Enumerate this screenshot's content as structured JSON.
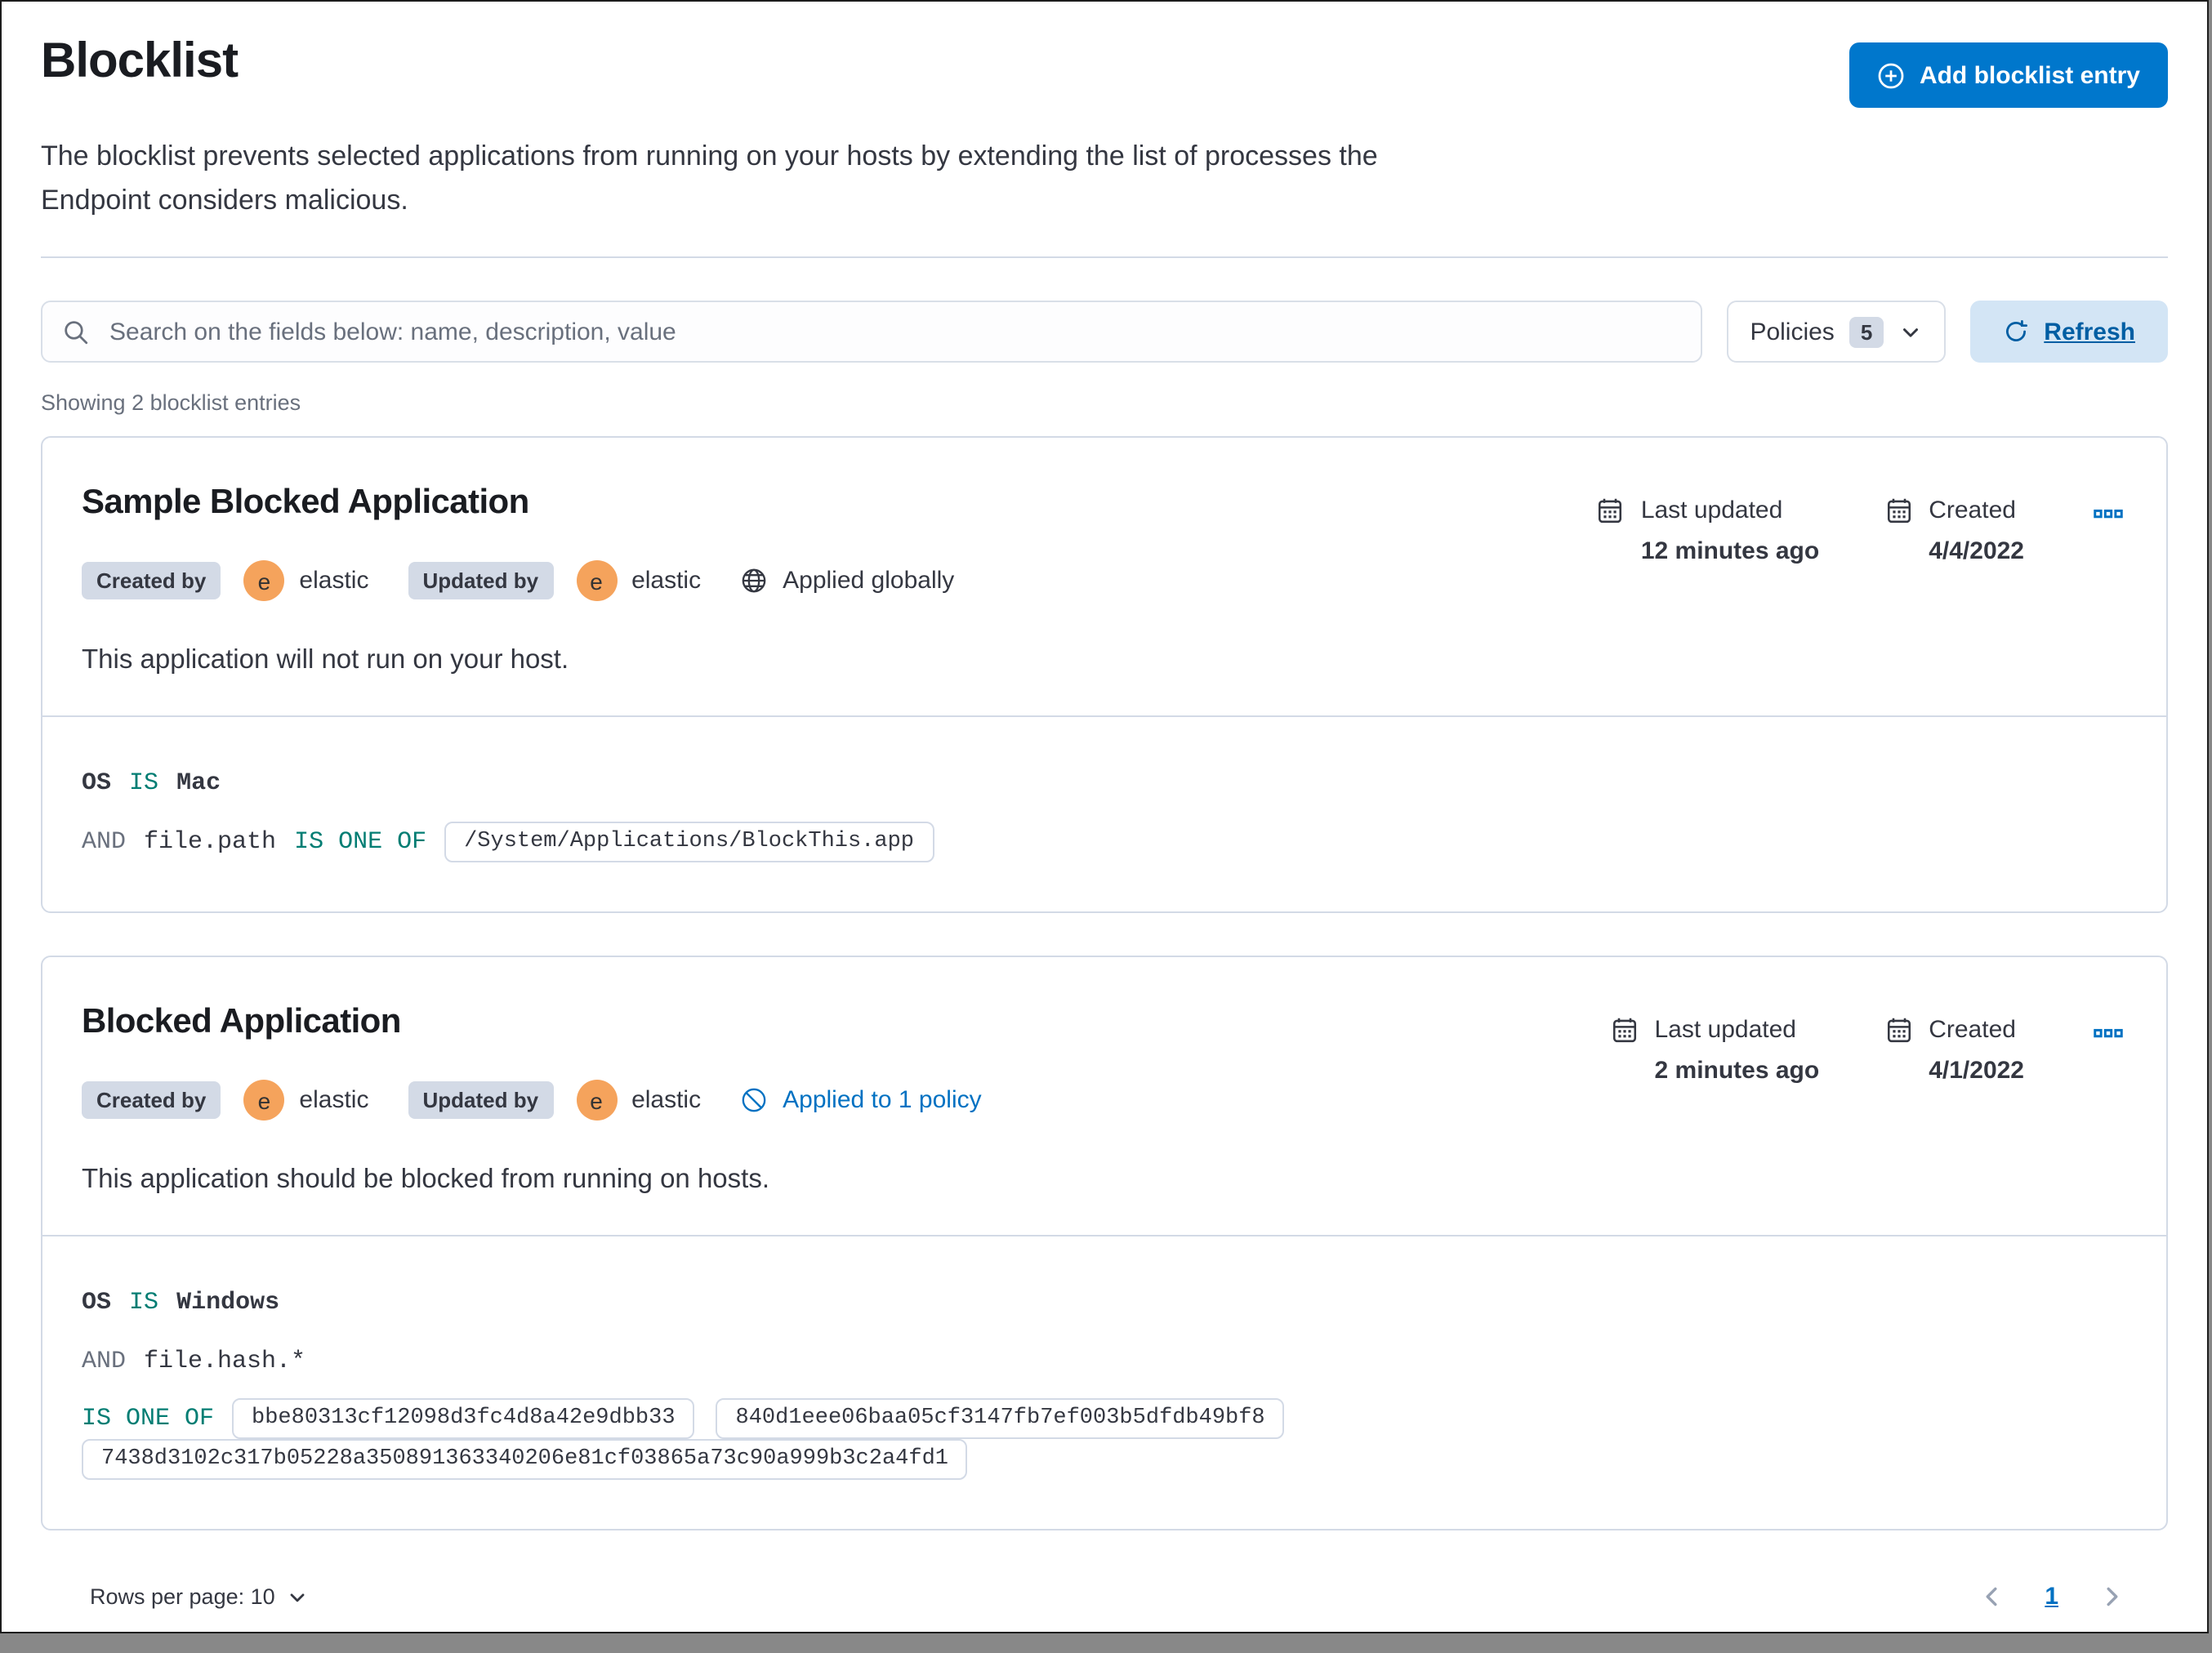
{
  "page": {
    "title": "Blocklist",
    "description_lines": [
      "The blocklist prevents selected applications from running on your hosts by extending the list of processes the",
      "Endpoint considers malicious."
    ]
  },
  "toolbar": {
    "add_button_label": "Add blocklist entry",
    "search_placeholder": "Search on the fields below: name, description, value",
    "policies_label": "Policies",
    "policies_count": "5",
    "refresh_label": "Refresh"
  },
  "list": {
    "showing_text": "Showing 2 blocklist entries"
  },
  "entries": [
    {
      "title": "Sample Blocked Application",
      "created_by": {
        "label": "Created by",
        "avatar_initial": "e",
        "user": "elastic"
      },
      "updated_by": {
        "label": "Updated by",
        "avatar_initial": "e",
        "user": "elastic"
      },
      "scope": {
        "type": "global",
        "label": "Applied globally"
      },
      "last_updated": {
        "label": "Last updated",
        "value": "12 minutes ago"
      },
      "created": {
        "label": "Created",
        "value": "4/4/2022"
      },
      "description": "This application will not run on your host.",
      "criteria_lines": [
        [
          {
            "t": "b",
            "v": "OS"
          },
          {
            "t": "op",
            "v": "IS"
          },
          {
            "t": "b",
            "v": "Mac"
          }
        ],
        [
          {
            "t": "conj",
            "v": "AND"
          },
          {
            "t": "f",
            "v": "file.path"
          },
          {
            "t": "op",
            "v": "IS ONE OF"
          },
          {
            "t": "pill",
            "v": "/System/Applications/BlockThis.app"
          }
        ]
      ]
    },
    {
      "title": "Blocked Application",
      "created_by": {
        "label": "Created by",
        "avatar_initial": "e",
        "user": "elastic"
      },
      "updated_by": {
        "label": "Updated by",
        "avatar_initial": "e",
        "user": "elastic"
      },
      "scope": {
        "type": "policy",
        "label": "Applied to 1 policy"
      },
      "last_updated": {
        "label": "Last updated",
        "value": "2 minutes ago"
      },
      "created": {
        "label": "Created",
        "value": "4/1/2022"
      },
      "description": "This application should be blocked from running on hosts.",
      "criteria_lines": [
        [
          {
            "t": "b",
            "v": "OS"
          },
          {
            "t": "op",
            "v": "IS"
          },
          {
            "t": "b",
            "v": "Windows"
          }
        ],
        [
          {
            "t": "conj",
            "v": "AND"
          },
          {
            "t": "f",
            "v": "file.hash.*"
          }
        ],
        [
          {
            "t": "op",
            "v": "IS ONE OF"
          },
          {
            "t": "pill",
            "v": "bbe80313cf12098d3fc4d8a42e9dbb33"
          },
          {
            "t": "pill",
            "v": "840d1eee06baa05cf3147fb7ef003b5dfdb49bf8"
          },
          {
            "t": "pill",
            "v": "7438d3102c317b05228a350891363340206e81cf03865a73c90a999b3c2a4fd1"
          }
        ]
      ]
    }
  ],
  "footer": {
    "rows_per_page_label": "Rows per page: 10",
    "page_number": "1"
  },
  "colors": {
    "primary_button": "#0077cc",
    "link": "#0071c2",
    "operator_teal": "#017d73",
    "badge_background": "#d3dae6",
    "avatar_background": "#f5a35c",
    "text": "#343741",
    "subdued_text": "#69707d",
    "border": "#d3dae6",
    "refresh_background": "#d3e5f5"
  }
}
